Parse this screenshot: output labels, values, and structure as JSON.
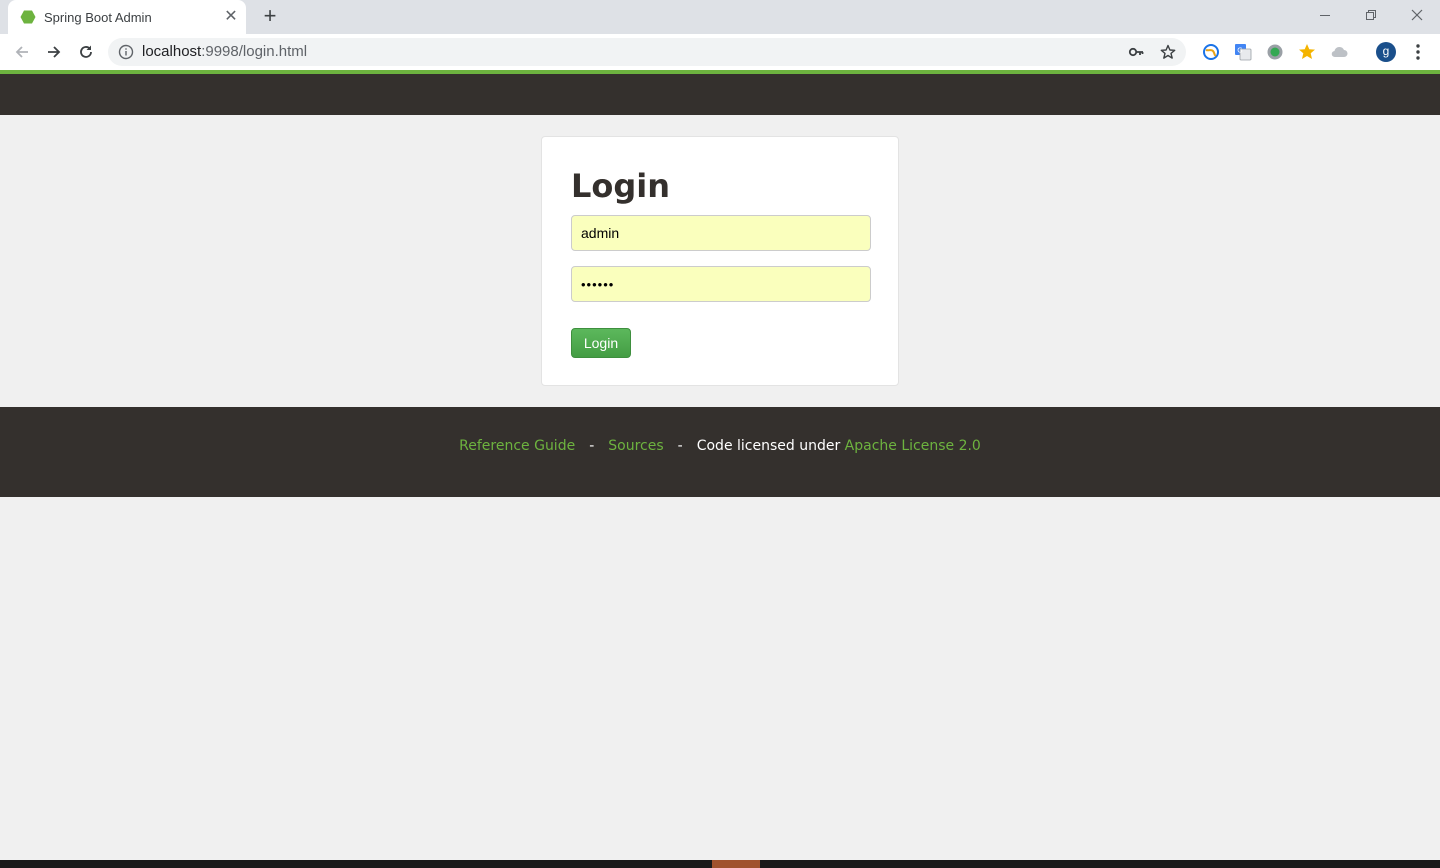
{
  "browser": {
    "tab_title": "Spring Boot Admin",
    "url_host": "localhost",
    "url_rest": ":9998/login.html",
    "new_tab_glyph": "+",
    "close_glyph": "✕",
    "avatar_letter": "g"
  },
  "icons": {
    "favicon": "spring-hexagon-icon",
    "back": "back-arrow-icon",
    "forward": "forward-arrow-icon",
    "reload": "reload-icon",
    "info": "info-icon",
    "key": "key-icon",
    "star": "star-icon"
  },
  "login": {
    "title": "Login",
    "username_value": "admin",
    "password_value": "••••••",
    "button_label": "Login"
  },
  "footer": {
    "reference_guide": "Reference Guide",
    "separator": "-",
    "sources": "Sources",
    "license_prefix": "Code licensed under ",
    "license_link": "Apache License 2.0"
  },
  "colors": {
    "brand_green": "#6db33f",
    "dark_bar": "#34302d",
    "autofill_yellow": "#faffbd",
    "button_green": "#5cb85c"
  }
}
